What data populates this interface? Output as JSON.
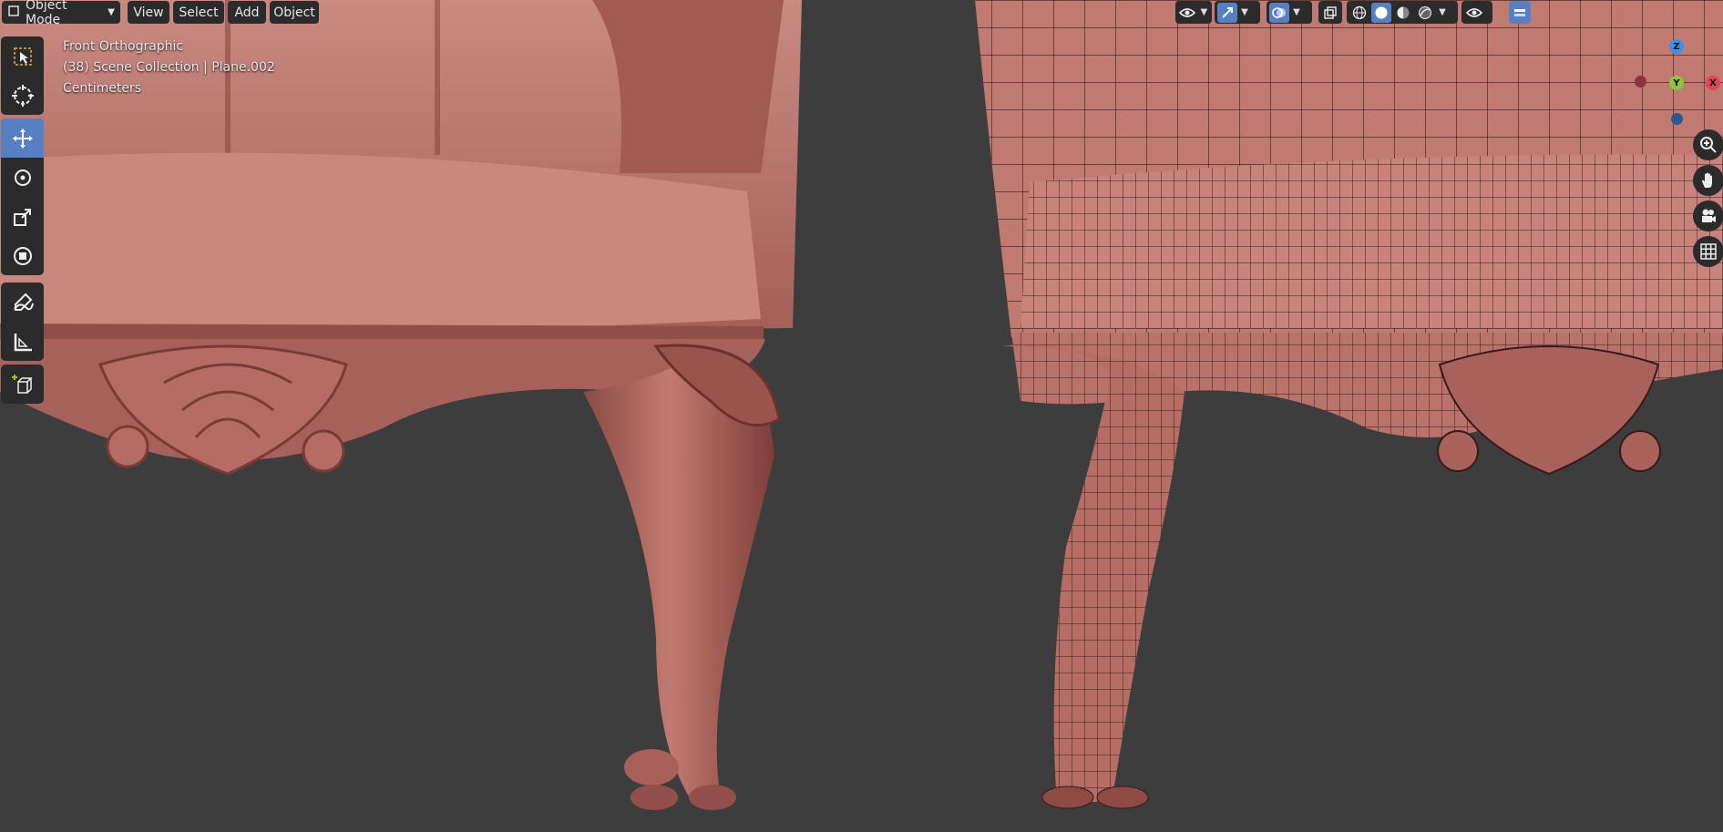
{
  "header": {
    "mode": "Object Mode",
    "menus": [
      "View",
      "Select",
      "Add",
      "Object"
    ]
  },
  "overlay": {
    "view_name": "Front Orthographic",
    "collection_info": "(38) Scene Collection | Plane.002",
    "units": "Centimeters"
  },
  "toolbar": {
    "tools": [
      "select-box-icon",
      "cursor-icon",
      "move-icon",
      "rotate-icon",
      "scale-icon",
      "transform-icon",
      "annotate-icon",
      "measure-icon",
      "add-cube-icon"
    ],
    "active_tool": "move-icon"
  },
  "gizmo": {
    "z_label": "Z",
    "y_label": "Y",
    "x_label": "X"
  },
  "colors": {
    "viewport_bg": "#3d3d3d",
    "header_bg": "#2b2b2b",
    "active_blue": "#5680c2",
    "clay": "#b86a62",
    "axis_x": "#e04455",
    "axis_y": "#8cc63f",
    "axis_z": "#3d8ee6"
  }
}
